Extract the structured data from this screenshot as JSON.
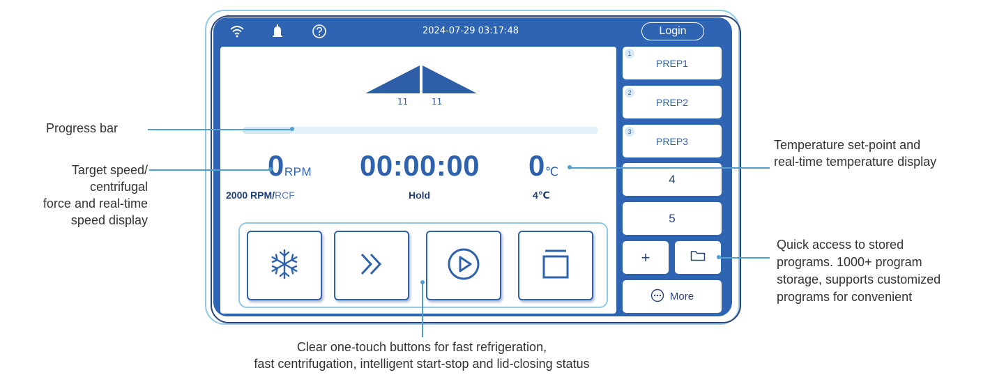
{
  "status_bar": {
    "datetime": "2024-07-29 03:17:48",
    "login_label": "Login",
    "icons": [
      "wifi-icon",
      "alarm-bell-icon",
      "help-icon"
    ]
  },
  "ramp": {
    "accel_label": "11",
    "decel_label": "11"
  },
  "progress": {
    "fraction": 0.14
  },
  "readouts": {
    "speed_value": "0",
    "speed_unit": "RPM",
    "speed_setpoint": "2000 RPM",
    "speed_separator": "/",
    "speed_alt_unit": "RCF",
    "timer_value": "00:00:00",
    "timer_mode": "Hold",
    "temp_value": "0",
    "temp_unit": "℃",
    "temp_setpoint": "4℃"
  },
  "actions": [
    {
      "name": "fast-refrigeration",
      "icon": "snowflake-icon"
    },
    {
      "name": "fast-centrifugation",
      "icon": "double-chevron-right-icon"
    },
    {
      "name": "start-stop",
      "icon": "play-circle-icon"
    },
    {
      "name": "lid-status",
      "icon": "lid-icon"
    }
  ],
  "programs": [
    {
      "badge": "1",
      "label": "PREP1"
    },
    {
      "badge": "2",
      "label": "PREP2"
    },
    {
      "badge": "3",
      "label": "PREP3"
    },
    {
      "badge": "",
      "label": "4"
    },
    {
      "badge": "",
      "label": "5"
    }
  ],
  "bottom_controls": {
    "add_symbol": "+",
    "more_label": "More"
  },
  "callouts": {
    "progress_bar": "Progress bar",
    "speed_1": "Target speed/",
    "speed_2": "centrifugal",
    "speed_3": "force and real-time",
    "speed_4": "speed display",
    "temp_1": "Temperature set-point and",
    "temp_2": "real-time temperature display",
    "programs_1": "Quick access to stored",
    "programs_2": "programs. 1000+  program",
    "programs_3": "storage, supports customized",
    "programs_4": "programs for convenient",
    "buttons_1": "Clear one-touch buttons for fast refrigeration,",
    "buttons_2": "fast centrifugation, intelligent start-stop and lid-closing status"
  },
  "colors": {
    "screen_blue": "#2f64b2",
    "accent_cyan": "#4fa0cf",
    "text_blue": "#2f62ad",
    "frame_navy": "#2a4378"
  }
}
